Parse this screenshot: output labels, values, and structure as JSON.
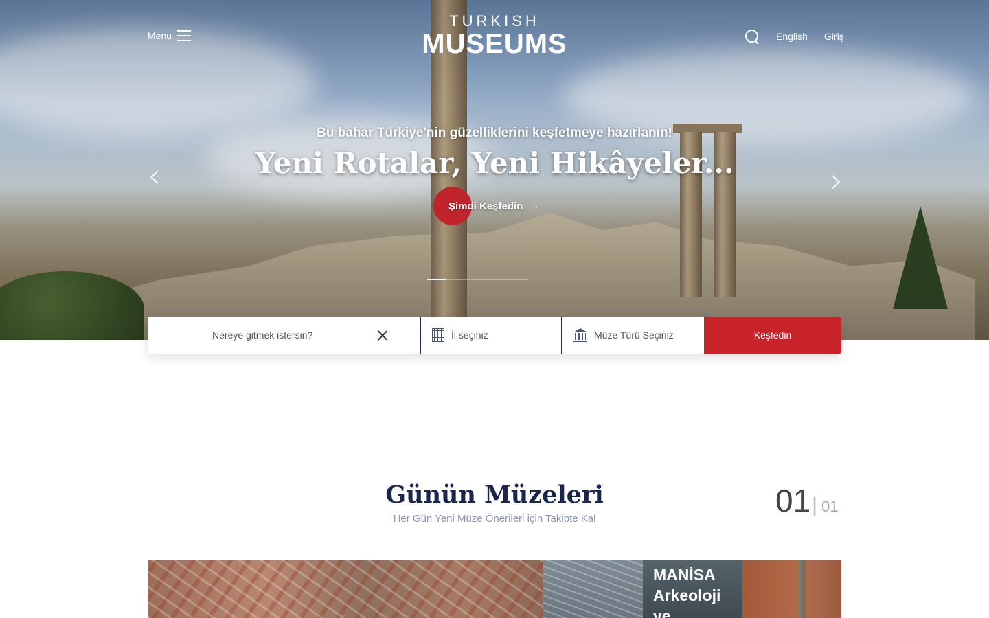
{
  "header": {
    "menu_label": "Menu",
    "logo_top": "TURKISH",
    "logo_main": "MUSEUMS",
    "language": "English",
    "login": "Giriş"
  },
  "hero": {
    "subtitle": "Bu bahar Türkiye'nin güzelliklerini keşfetmeye hazırlanın!",
    "title": "Yeni Rotalar, Yeni Hikâyeler...",
    "cta_label": "Şimdi Keşfedin",
    "cta_arrow": "→",
    "slides_total": 4,
    "active_slide": 1
  },
  "search": {
    "where_placeholder": "Nereye gitmek istersin?",
    "city_label": "İl seçiniz",
    "type_label": "Müze Türü Seçiniz",
    "submit_label": "Keşfedin"
  },
  "section": {
    "title": "Günün Müzeleri",
    "subtitle": "Her Gün Yeni Müze Önerileri için Takipte Kal",
    "counter_current": "01",
    "counter_separator": "|",
    "counter_total": "01"
  },
  "cards": {
    "featured_title": "MANİSA Arkeoloji ve"
  },
  "colors": {
    "accent_red": "#c8232b",
    "navy": "#1a2550",
    "subtitle_blue": "#8a95b8"
  },
  "icons": {
    "menu": "hamburger-icon",
    "search": "search-icon",
    "clear": "close-icon",
    "city": "building-icon",
    "museum_type": "museum-icon",
    "prev": "chevron-left-icon",
    "next": "chevron-right-icon"
  }
}
